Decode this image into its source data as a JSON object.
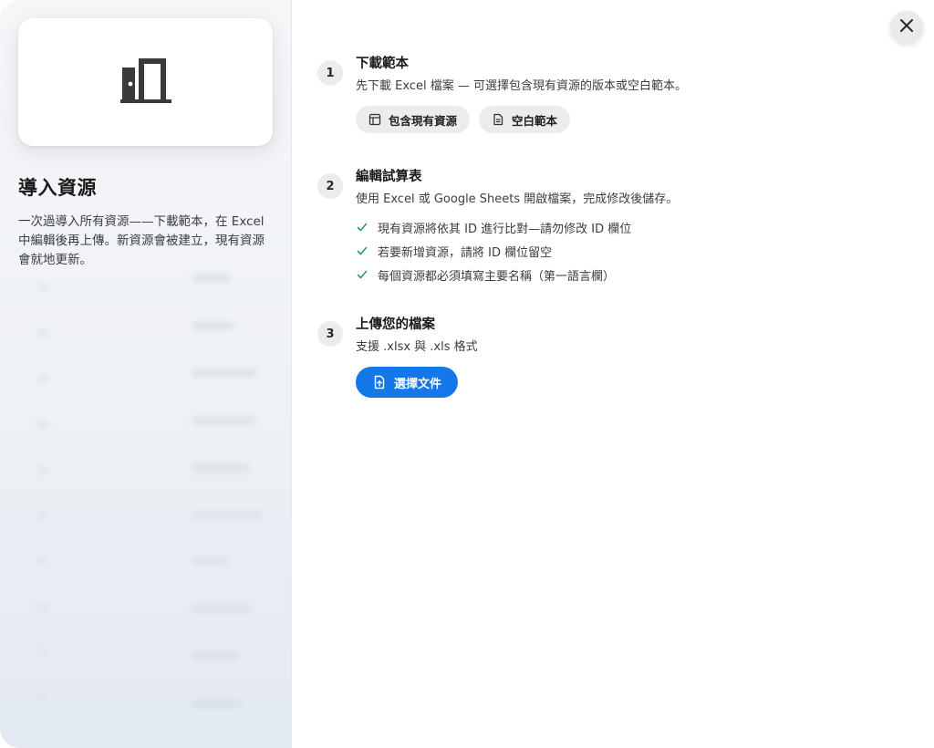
{
  "left": {
    "title": "導入資源",
    "description": "一次過導入所有資源——下載範本，在 Excel 中編輯後再上傳。新資源會被建立，現有資源會就地更新。",
    "preview_icon": "door-icon"
  },
  "steps": [
    {
      "number": "1",
      "title": "下載範本",
      "description": "先下載 Excel 檔案 — 可選擇包含現有資源的版本或空白範本。",
      "buttons": [
        {
          "label": "包含現有資源",
          "icon": "table-icon"
        },
        {
          "label": "空白範本",
          "icon": "document-icon"
        }
      ]
    },
    {
      "number": "2",
      "title": "編輯試算表",
      "description": "使用 Excel 或 Google Sheets 開啟檔案，完成修改後儲存。",
      "checklist": [
        "現有資源將依其 ID 進行比對—請勿修改 ID 欄位",
        "若要新增資源，請將 ID 欄位留空",
        "每個資源都必須填寫主要名稱（第一語言欄）"
      ]
    },
    {
      "number": "3",
      "title": "上傳您的檔案",
      "description": "支援 .xlsx 與 .xls 格式",
      "upload_label": "選擇文件",
      "upload_icon": "file-upload-icon"
    }
  ],
  "close_icon": "close-icon",
  "colors": {
    "accent": "#1478e8",
    "check": "#2e9e5b"
  }
}
